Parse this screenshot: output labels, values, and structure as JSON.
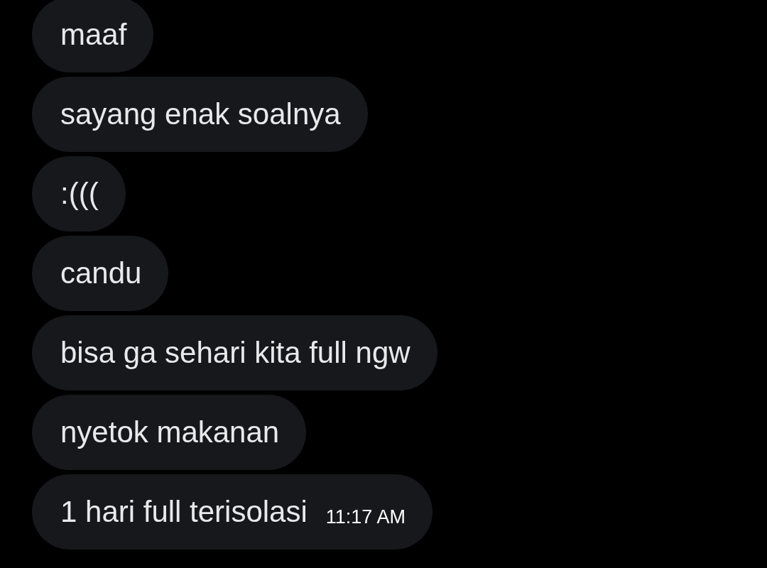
{
  "messages": [
    {
      "text": "maaf"
    },
    {
      "text": "sayang enak soalnya"
    },
    {
      "text": ":((("
    },
    {
      "text": "candu"
    },
    {
      "text": "bisa ga sehari kita full ngw"
    },
    {
      "text": "nyetok makanan"
    },
    {
      "text": "1 hari full terisolasi",
      "time": "11:17 AM"
    }
  ]
}
